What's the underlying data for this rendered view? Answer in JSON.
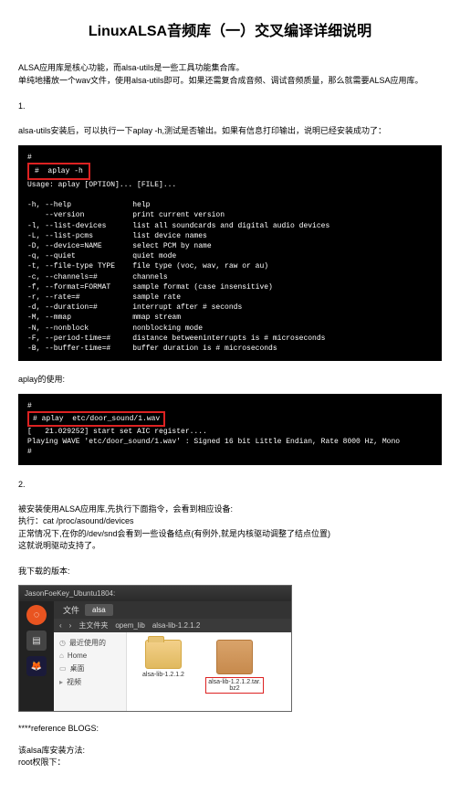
{
  "title": "LinuxALSA音频库（一）交叉编译详细说明",
  "intro1": "ALSA应用库是核心功能，而alsa-utils是一些工具功能集合库。",
  "intro2": "单纯地播放一个wav文件，使用alsa-utils即可。如果还需复合成音频、调试音频质量，那么就需要ALSA应用库。",
  "sec1": "1.",
  "sec1text": "alsa-utils安装后，可以执行一下aplay -h,测试是否输出。如果有信息打印输出，说明已经安装成功了：",
  "term1": {
    "cmd": "#  aplay -h",
    "usage": "Usage: aplay [OPTION]... [FILE]...",
    "lines": [
      "-h, --help              help",
      "    --version           print current version",
      "-l, --list-devices      list all soundcards and digital audio devices",
      "-L, --list-pcms         list device names",
      "-D, --device=NAME       select PCM by name",
      "-q, --quiet             quiet mode",
      "-t, --file-type TYPE    file type (voc, wav, raw or au)",
      "-c, --channels=#        channels",
      "-f, --format=FORMAT     sample format (case insensitive)",
      "-r, --rate=#            sample rate",
      "-d, --duration=#        interrupt after # seconds",
      "-M, --mmap              mmap stream",
      "-N, --nonblock          nonblocking mode",
      "-F, --period-time=#     distance betweeninterrupts is # microseconds",
      "-B, --buffer-time=#     buffer duration is # microseconds"
    ]
  },
  "aplay_use": "aplay的使用:",
  "term2": {
    "prompt": "#",
    "cmd": "# aplay  etc/door_sound/1.wav",
    "out1": "[   21.029252] start set AIC register....",
    "out2": "Playing WAVE 'etc/door_sound/1.wav' : Signed 16 bit Little Endian, Rate 8000 Hz, Mono",
    "out3": "#"
  },
  "sec2": "2.",
  "sec2_l1": "被安装使用ALSA应用库,先执行下面指令，会看到相应设备:",
  "sec2_l2": "执行：cat /proc/asound/devices",
  "sec2_l3": "正常情况下,在你的/dev/snd会看到一些设备结点(有例外,就是内核驱动调整了结点位置)",
  "sec2_l4": "这就说明驱动支持了。",
  "download": "我下载的版本:",
  "fm": {
    "wintitle": "JasonFoeKey_Ubuntu1804:",
    "tab": "文件",
    "pathlabel": "alsa",
    "crumb1": "主文件夹",
    "crumb2": "opem_lib",
    "crumb3": "alsa-lib-1.2.1.2",
    "nav_recent": "最近使用的",
    "nav_home": "Home",
    "nav_desktop": "桌面",
    "nav_video": "视频",
    "folder1": "alsa-lib-1.2.1.2",
    "folder2": "alsa-lib-1.2.1.2.tar.bz2"
  },
  "ref": "****reference BLOGS:",
  "install1": "该alsa库安装方法:",
  "install2": "root权限下："
}
